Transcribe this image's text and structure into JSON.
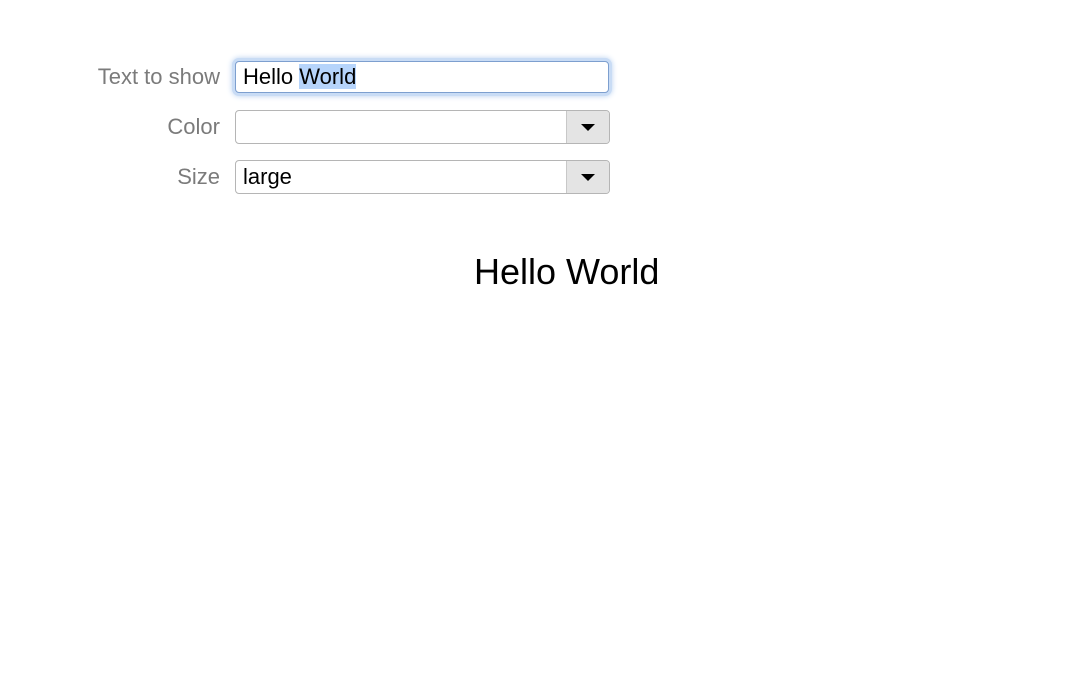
{
  "form": {
    "text_field": {
      "label": "Text to show",
      "value_plain": "Hello ",
      "value_selected": "World"
    },
    "color_field": {
      "label": "Color",
      "value": ""
    },
    "size_field": {
      "label": "Size",
      "value": "large"
    }
  },
  "output": {
    "text": "Hello World"
  },
  "colors": {
    "selection_highlight": "#b6d4fb",
    "label_text": "#7b7b7b",
    "focus_ring": "#c9dcf5"
  },
  "icons": {
    "dropdown": "chevron-down-icon"
  }
}
